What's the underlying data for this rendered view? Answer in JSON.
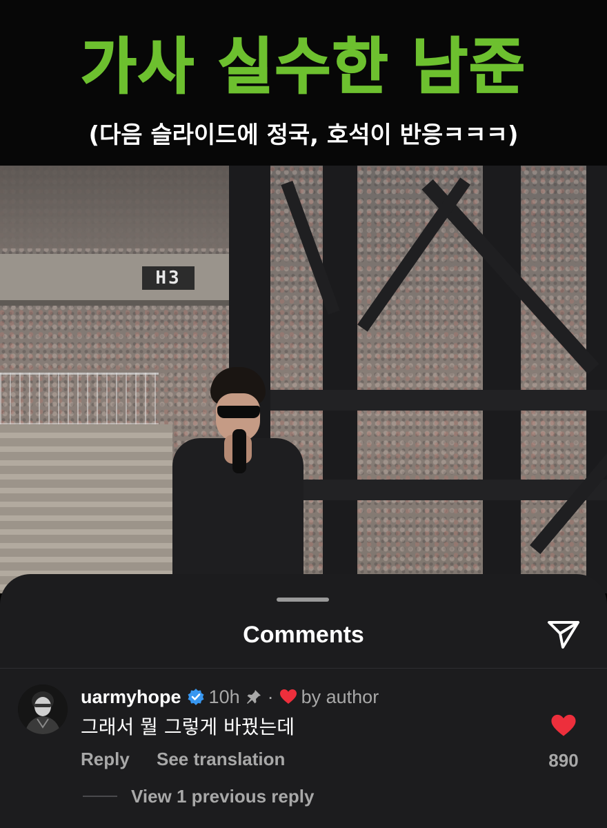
{
  "post_overlay": {
    "title": "가사 실수한 남준",
    "subtitle": "(다음 슬라이드에 정국, 호석이 반응ㅋㅋㅋ)",
    "title_color": "#6dc02f"
  },
  "photo": {
    "sector_sign": "H3"
  },
  "comments_sheet": {
    "title": "Comments",
    "share_icon": "paper-plane-icon",
    "comment": {
      "username": "uarmyhope",
      "verified_icon": "verified-badge-icon",
      "time": "10h",
      "pin_icon": "pin-icon",
      "separator": "·",
      "liked_by_author_icon": "heart-icon",
      "liked_by_author_label": "by author",
      "text": "그래서 뭘 그렇게 바꿨는데",
      "reply_label": "Reply",
      "translate_label": "See translation",
      "like_icon": "heart-filled-icon",
      "like_count": "890",
      "like_color": "#ed2f3c",
      "view_replies_label": "View 1 previous reply"
    }
  }
}
